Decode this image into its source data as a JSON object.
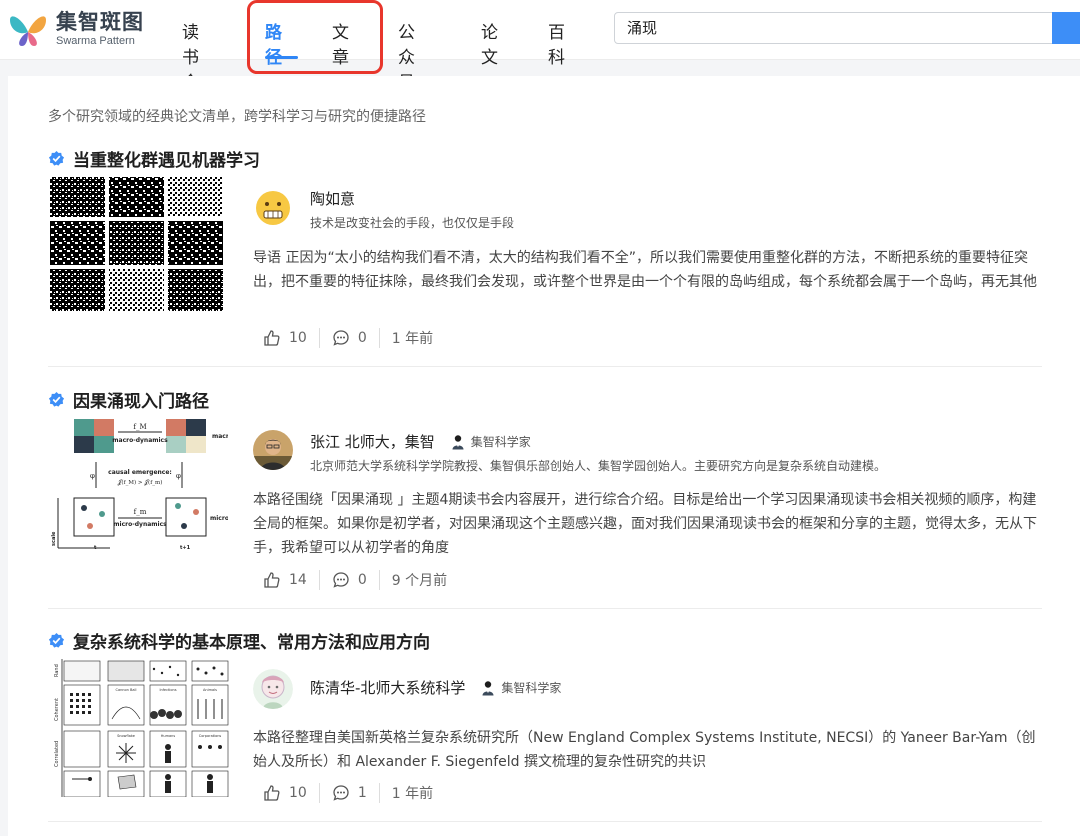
{
  "logo": {
    "cn": "集智斑图",
    "en": "Swarma Pattern"
  },
  "nav": {
    "items": [
      "读书会",
      "路径",
      "文章",
      "公众号",
      "论文",
      "百科"
    ],
    "active": "路径"
  },
  "search": {
    "value": "涌现"
  },
  "tagline": "多个研究领域的经典论文清单，跨学科学习与研究的便捷路径",
  "items": [
    {
      "title": "当重整化群遇见机器学习",
      "author": "陶如意",
      "role": "",
      "bio": "技术是改变社会的手段，也仅仅是手段",
      "summary": "导语 正因为“太小的结构我们看不清，太大的结构我们看不全”，所以我们需要使用重整化群的方法，不断把系统的重要特征突出，把不重要的特征抹除，最终我们会发现，或许整个世界是由一个个有限的岛屿组成，每个系统都会属于一个岛屿，再无其他",
      "likes": "10",
      "comments": "0",
      "time": "1 年前"
    },
    {
      "title": "因果涌现入门路径",
      "author": "张江 北师大，集智",
      "role": "集智科学家",
      "bio": "北京师范大学系统科学学院教授、集智俱乐部创始人、集智学园创始人。主要研究方向是复杂系统自动建模。",
      "summary": "本路径围绕「因果涌现 」主题4期读书会内容展开，进行综合介绍。目标是给出一个学习因果涌现读书会相关视频的顺序，构建全局的框架。如果你是初学者，对因果涌现这个主题感兴趣，面对我们因果涌现读书会的框架和分享的主题，觉得太多，无从下手，我希望可以从初学者的角度",
      "likes": "14",
      "comments": "0",
      "time": "9 个月前",
      "figure": {
        "f_M": "f_M",
        "macro_dynamics": "macro-dynamics",
        "macro": "macro",
        "causal": "causal emergence:",
        "formula": "𝒥(f_M) > 𝒥(f_m)",
        "f_m": "f_m",
        "micro_dynamics": "micro-dynamics",
        "micro": "micro",
        "phi": "φ",
        "coarse": "coarse-graining",
        "scale": "scale",
        "t": "t",
        "t1": "t+1"
      }
    },
    {
      "title": "复杂系统科学的基本原理、常用方法和应用方向",
      "author": "陈清华-北师大系统科学",
      "role": "集智科学家",
      "bio": "",
      "summary": "本路径整理自美国新英格兰复杂系统研究所（New England Complex Systems Institute, NECSI）的 Yaneer Bar-Yam（创始人及所长）和 Alexander F. Siegenfeld 撰文梳理的复杂性研究的共识",
      "likes": "10",
      "comments": "1",
      "time": "1 年前",
      "figure": {
        "random": "Rand",
        "coherent": "Coherent",
        "correlated": "Correlated",
        "cells": [
          "Cannon Ball",
          "Infections",
          "Animals",
          "Snowflake",
          "Humans",
          "Corporations"
        ]
      }
    }
  ],
  "colors": {
    "accent": "#2f86f6",
    "highlight": "#e8362c",
    "badge": "#3d8ef7"
  }
}
